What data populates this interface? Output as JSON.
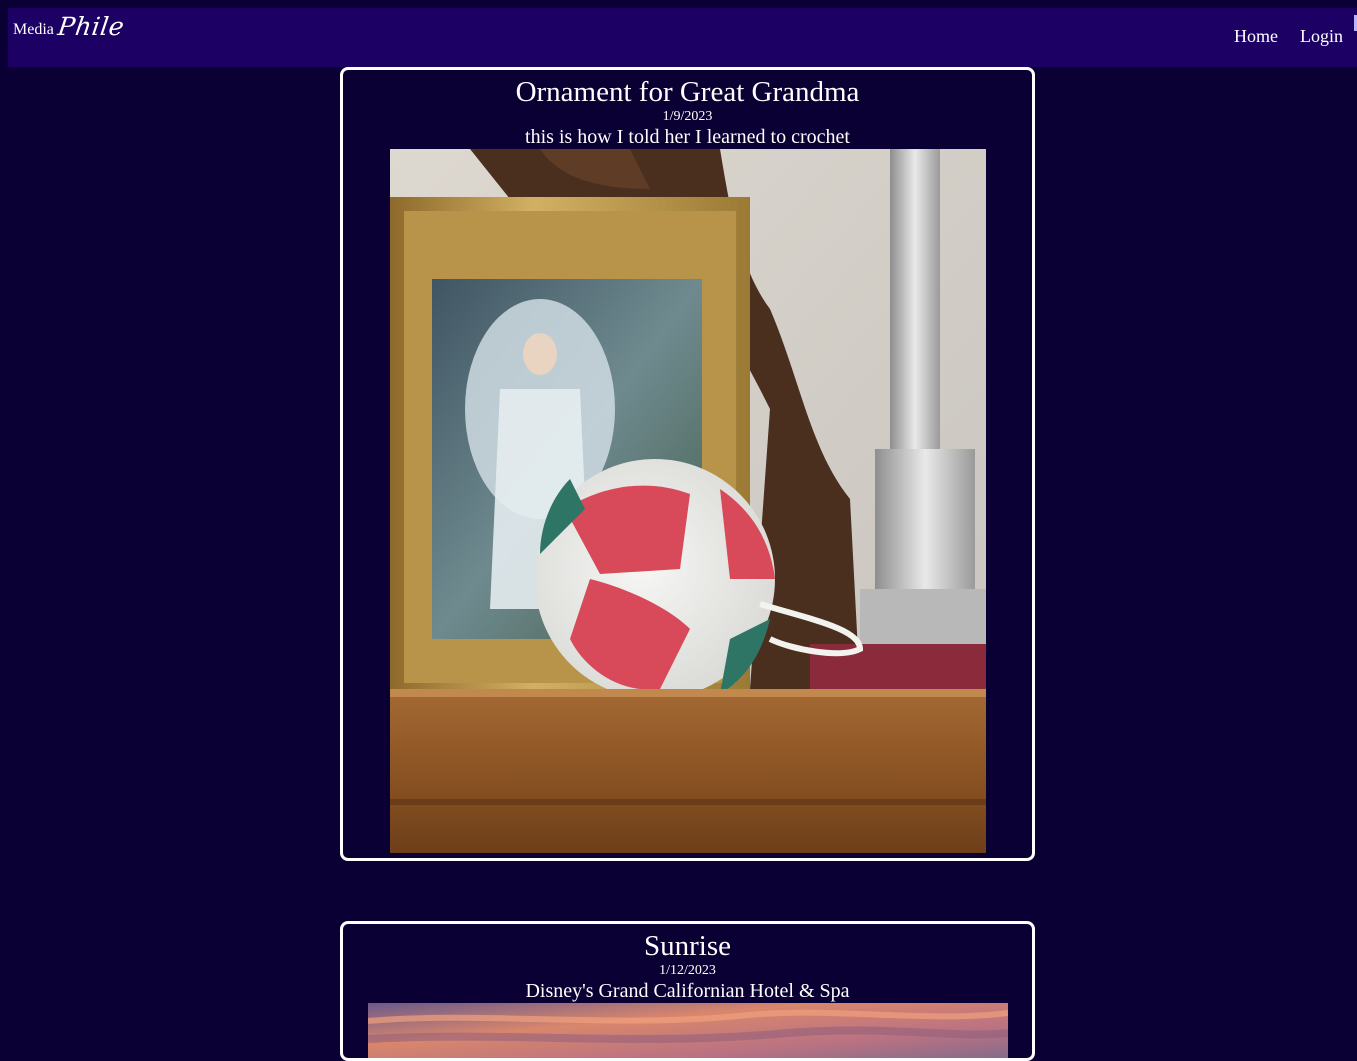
{
  "brand": {
    "media": "Media",
    "phile": "Phile"
  },
  "nav": {
    "home": "Home",
    "login": "Login"
  },
  "posts": [
    {
      "title": "Ornament for Great Grandma",
      "date": "1/9/2023",
      "description": "this is how I told her I learned to crochet",
      "image": "crochet-ornament-photo"
    },
    {
      "title": "Sunrise",
      "date": "1/12/2023",
      "description": "Disney's Grand Californian Hotel & Spa",
      "image": "sunrise-photo"
    }
  ],
  "colors": {
    "background": "#0b0033",
    "navbar": "#1c0063",
    "card_border": "#ffffff",
    "text": "#ffffff"
  }
}
